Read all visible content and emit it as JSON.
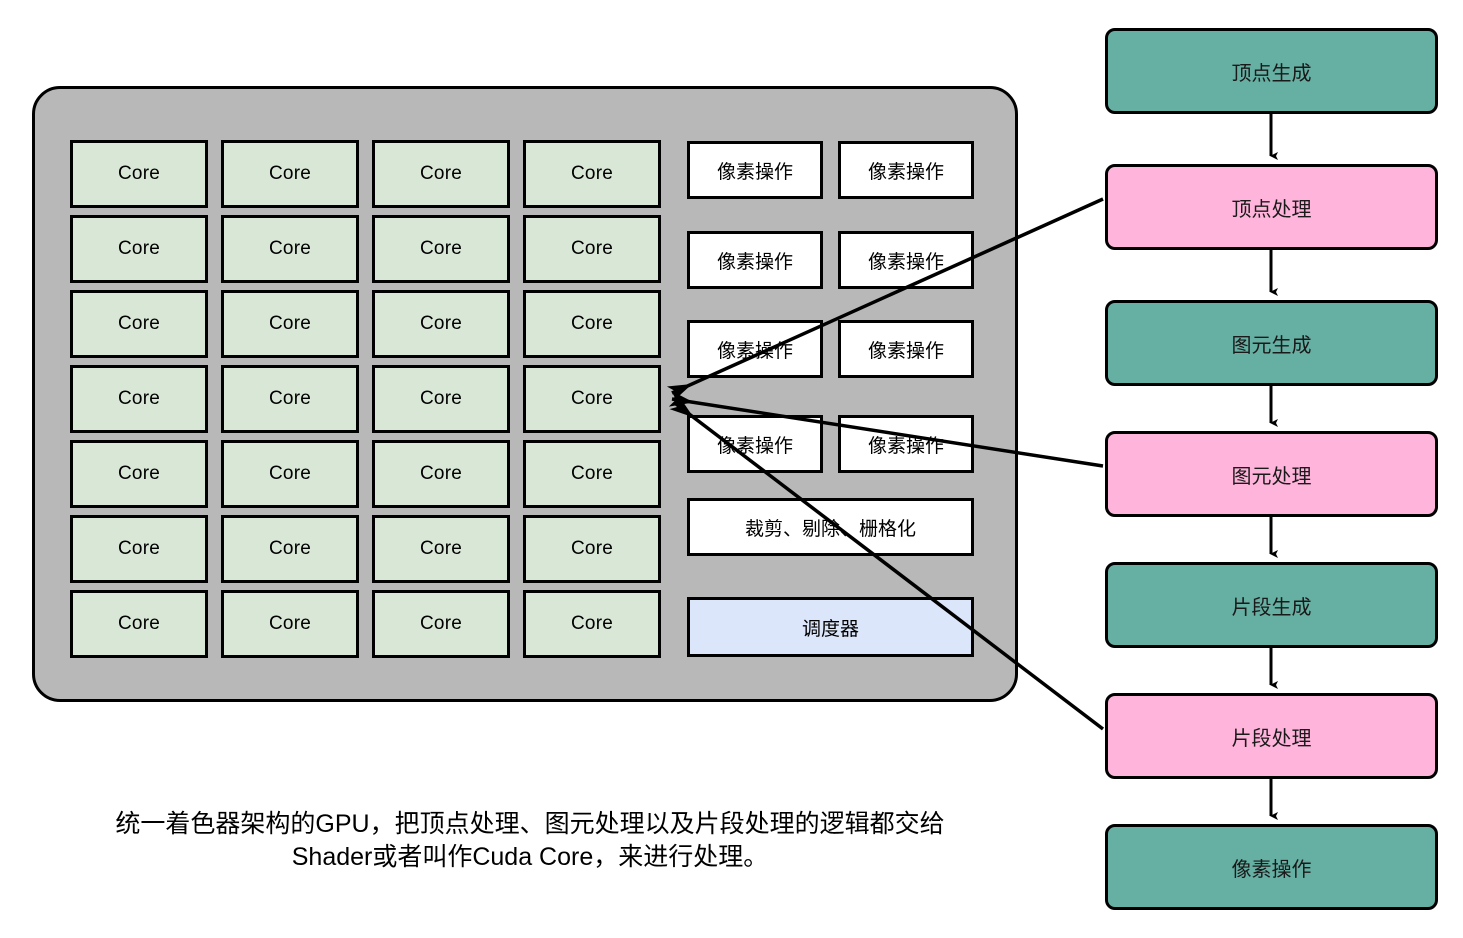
{
  "diagram": {
    "title_caption": "统一着色器架构的GPU，把顶点处理、图元处理以及片段处理的逻辑都交给\nShader或者叫作Cuda Core，来进行处理。",
    "colors": {
      "gpu_container_fill": "#b8b8b8",
      "core_fill": "#d9e7d7",
      "unit_fill": "#ffffff",
      "scheduler_fill": "#dce6fa",
      "stage_generate_fill": "#66afa3",
      "stage_process_fill": "#ffb5db",
      "stroke": "#000000"
    }
  },
  "gpu": {
    "cores": [
      {
        "label": "Core"
      },
      {
        "label": "Core"
      },
      {
        "label": "Core"
      },
      {
        "label": "Core"
      },
      {
        "label": "Core"
      },
      {
        "label": "Core"
      },
      {
        "label": "Core"
      },
      {
        "label": "Core"
      },
      {
        "label": "Core"
      },
      {
        "label": "Core"
      },
      {
        "label": "Core"
      },
      {
        "label": "Core"
      },
      {
        "label": "Core"
      },
      {
        "label": "Core"
      },
      {
        "label": "Core"
      },
      {
        "label": "Core"
      },
      {
        "label": "Core"
      },
      {
        "label": "Core"
      },
      {
        "label": "Core"
      },
      {
        "label": "Core"
      },
      {
        "label": "Core"
      },
      {
        "label": "Core"
      },
      {
        "label": "Core"
      },
      {
        "label": "Core"
      },
      {
        "label": "Core"
      },
      {
        "label": "Core"
      },
      {
        "label": "Core"
      },
      {
        "label": "Core"
      }
    ],
    "pixel_ops": [
      {
        "label": "像素操作"
      },
      {
        "label": "像素操作"
      },
      {
        "label": "像素操作"
      },
      {
        "label": "像素操作"
      },
      {
        "label": "像素操作"
      },
      {
        "label": "像素操作"
      },
      {
        "label": "像素操作"
      },
      {
        "label": "像素操作"
      }
    ],
    "clip_cull_raster": {
      "label": "裁剪、剔除、栅格化"
    },
    "scheduler": {
      "label": "调度器"
    }
  },
  "pipeline": {
    "stages": [
      {
        "label": "顶点生成",
        "kind": "generate"
      },
      {
        "label": "顶点处理",
        "kind": "process"
      },
      {
        "label": "图元生成",
        "kind": "generate"
      },
      {
        "label": "图元处理",
        "kind": "process"
      },
      {
        "label": "片段生成",
        "kind": "generate"
      },
      {
        "label": "片段处理",
        "kind": "process"
      },
      {
        "label": "像素操作",
        "kind": "generate"
      }
    ]
  }
}
